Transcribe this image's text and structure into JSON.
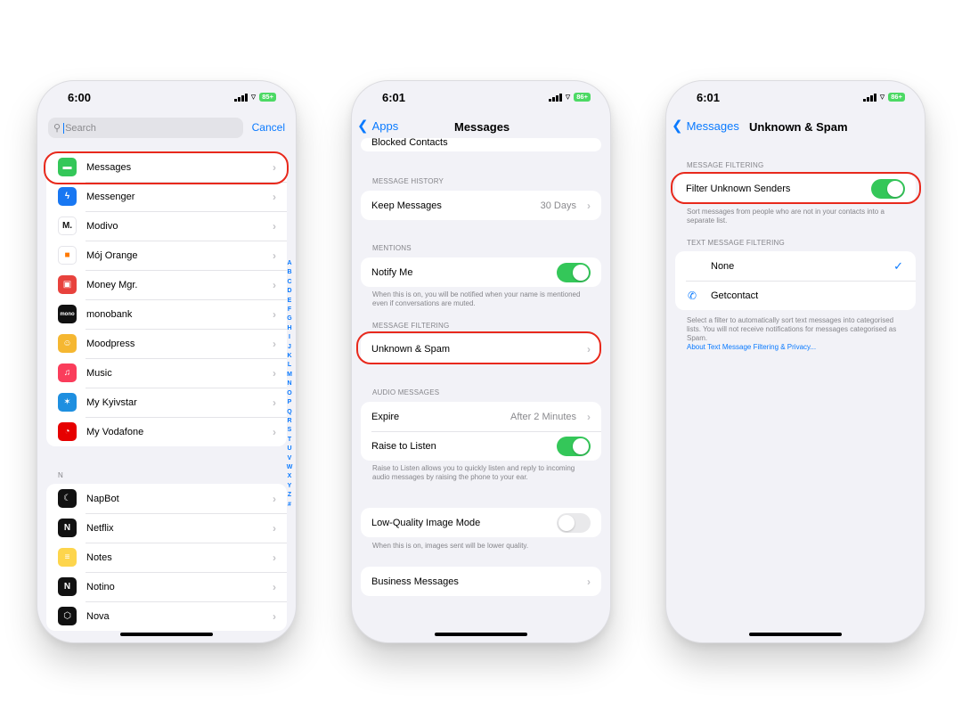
{
  "colors": {
    "accent": "#0a7aff",
    "toggle_on": "#34c759",
    "highlight": "#e8291c",
    "background": "#f2f2f7"
  },
  "phone1": {
    "status": {
      "time": "6:00",
      "battery": "85+"
    },
    "search": {
      "placeholder": "Search",
      "cancel": "Cancel"
    },
    "apps_group1": [
      {
        "label": "Messages",
        "icon": "messages-icon",
        "color": "#34c759",
        "glyph": "▬"
      },
      {
        "label": "Messenger",
        "icon": "messenger-icon",
        "color": "#1877f2",
        "glyph": "ϟ"
      },
      {
        "label": "Modivo",
        "icon": "modivo-icon",
        "color": "#ffffff",
        "glyph": "M."
      },
      {
        "label": "Mój Orange",
        "icon": "orange-icon",
        "color": "#ffffff",
        "glyph": "■"
      },
      {
        "label": "Money Mgr.",
        "icon": "money-manager-icon",
        "color": "#e8423d",
        "glyph": "▣"
      },
      {
        "label": "monobank",
        "icon": "monobank-icon",
        "color": "#111111",
        "glyph": "mono"
      },
      {
        "label": "Moodpress",
        "icon": "moodpress-icon",
        "color": "#f5b731",
        "glyph": "☺"
      },
      {
        "label": "Music",
        "icon": "music-icon",
        "color": "#fa3d5b",
        "glyph": "♫"
      },
      {
        "label": "My Kyivstar",
        "icon": "kyivstar-icon",
        "color": "#1e8fe0",
        "glyph": "✶"
      },
      {
        "label": "My Vodafone",
        "icon": "vodafone-icon",
        "color": "#e60000",
        "glyph": "◔"
      }
    ],
    "section_n": "N",
    "apps_group2": [
      {
        "label": "NapBot",
        "icon": "napbot-icon",
        "color": "#111111",
        "glyph": "☾"
      },
      {
        "label": "Netflix",
        "icon": "netflix-icon",
        "color": "#111111",
        "glyph": "N"
      },
      {
        "label": "Notes",
        "icon": "notes-icon",
        "color": "#fdd54c",
        "glyph": "≡"
      },
      {
        "label": "Notino",
        "icon": "notino-icon",
        "color": "#111111",
        "glyph": "N"
      },
      {
        "label": "Nova",
        "icon": "nova-icon",
        "color": "#111111",
        "glyph": "⬡"
      }
    ],
    "alpha_index": [
      "A",
      "B",
      "C",
      "D",
      "E",
      "F",
      "G",
      "H",
      "I",
      "J",
      "K",
      "L",
      "M",
      "N",
      "O",
      "P",
      "Q",
      "R",
      "S",
      "T",
      "U",
      "V",
      "W",
      "X",
      "Y",
      "Z",
      "#"
    ]
  },
  "phone2": {
    "status": {
      "time": "6:01",
      "battery": "86+"
    },
    "nav": {
      "back": "Apps",
      "title": "Messages"
    },
    "blocked_contacts": "Blocked Contacts",
    "message_history": {
      "header": "MESSAGE HISTORY",
      "keep_label": "Keep Messages",
      "keep_value": "30 Days"
    },
    "mentions": {
      "header": "MENTIONS",
      "notify_label": "Notify Me",
      "footnote": "When this is on, you will be notified when your name is mentioned even if conversations are muted."
    },
    "message_filtering": {
      "header": "MESSAGE FILTERING",
      "unknown_spam": "Unknown & Spam"
    },
    "audio_messages": {
      "header": "AUDIO MESSAGES",
      "expire_label": "Expire",
      "expire_value": "After 2 Minutes",
      "raise_label": "Raise to Listen",
      "footnote": "Raise to Listen allows you to quickly listen and reply to incoming audio messages by raising the phone to your ear."
    },
    "low_quality": {
      "label": "Low-Quality Image Mode",
      "footnote": "When this is on, images sent will be lower quality."
    },
    "business_messages": "Business Messages"
  },
  "phone3": {
    "status": {
      "time": "6:01",
      "battery": "86+"
    },
    "nav": {
      "back": "Messages",
      "title": "Unknown & Spam"
    },
    "message_filtering": {
      "header": "MESSAGE FILTERING",
      "filter_label": "Filter Unknown Senders",
      "footnote": "Sort messages from people who are not in your contacts into a separate list."
    },
    "text_filtering": {
      "header": "TEXT MESSAGE FILTERING",
      "none_label": "None",
      "getcontact_label": "Getcontact",
      "footnote": "Select a filter to automatically sort text messages into categorised lists. You will not receive notifications for messages categorised as Spam.",
      "link": "About Text Message Filtering & Privacy..."
    }
  }
}
